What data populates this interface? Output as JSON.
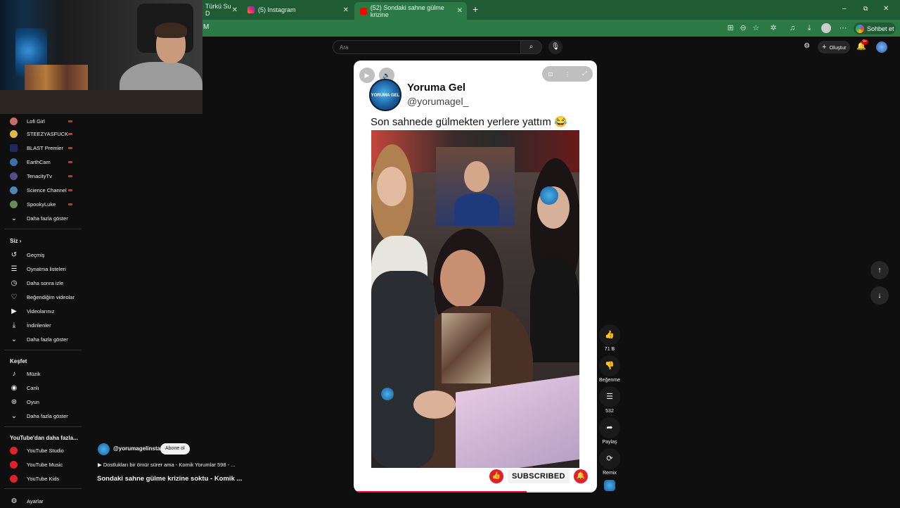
{
  "browser": {
    "tabs": [
      {
        "label": "Türkü Su D",
        "active": false
      },
      {
        "label": "(5) Instagram",
        "active": false
      },
      {
        "label": "(52) Sondaki sahne gülme krizine",
        "active": true
      }
    ],
    "new_tab": "+",
    "url_fragment": "M",
    "chat_button": "Sohbet et",
    "theme_color": "#2b7a45"
  },
  "youtube": {
    "search_placeholder": "Ara",
    "create_label": "Oluştur",
    "notif_count": "9+"
  },
  "sidebar": {
    "subscriptions": [
      {
        "label": "Lofi Girl",
        "color": "#c96b6b"
      },
      {
        "label": "STEEZYASFUCK",
        "color": "#e0b84a"
      },
      {
        "label": "BLAST Premier",
        "color": "#1d2a5a"
      },
      {
        "label": "EarthCam",
        "color": "#3b6fae"
      },
      {
        "label": "TenacityTv",
        "color": "#5a4a8a"
      },
      {
        "label": "Science Channel",
        "color": "#4a8ab0"
      },
      {
        "label": "SpookyLuke",
        "color": "#6a8a5a"
      }
    ],
    "show_more": "Daha fazla göster",
    "you_heading": "Siz",
    "you_items": [
      {
        "label": "Geçmiş",
        "icon": "history-icon",
        "glyph": "↺"
      },
      {
        "label": "Oynatma listeleri",
        "icon": "playlist-icon",
        "glyph": "☰"
      },
      {
        "label": "Daha sonra izle",
        "icon": "clock-icon",
        "glyph": "◷"
      },
      {
        "label": "Beğendiğim videolar",
        "icon": "thumbs-up-icon",
        "glyph": "👍"
      },
      {
        "label": "Videolarınız",
        "icon": "video-icon",
        "glyph": "▶"
      },
      {
        "label": "İndirilenler",
        "icon": "download-icon",
        "glyph": "⤓"
      }
    ],
    "show_more_2": "Daha fazla göster",
    "explore_heading": "Keşfet",
    "explore_items": [
      {
        "label": "Müzik",
        "icon": "music-icon",
        "glyph": "♪"
      },
      {
        "label": "Canlı",
        "icon": "live-icon",
        "glyph": "((•))"
      },
      {
        "label": "Oyun",
        "icon": "gamepad-icon",
        "glyph": "⊛"
      }
    ],
    "show_more_3": "Daha fazla göster",
    "more_heading": "YouTube'dan daha fazla...",
    "more_items": [
      {
        "label": "YouTube Studio",
        "color": "#e0202a"
      },
      {
        "label": "YouTube Music",
        "color": "#e0202a"
      },
      {
        "label": "YouTube Kids",
        "color": "#e0202a"
      }
    ],
    "settings": "Ayarlar"
  },
  "short": {
    "channel_name": "Yoruma Gel",
    "channel_handle": "@yorumagel_",
    "logo_text": "YORUMA GEL",
    "caption": "Son sahnede gülmekten yerlere yattım 😂",
    "subscribed_label": "SUBSCRIBED",
    "progress": 0.71
  },
  "actions": {
    "like_count": "71 B",
    "dislike_label": "Beğenme",
    "comment_count": "532",
    "share_label": "Paylaş",
    "remix_label": "Remix"
  },
  "info": {
    "handle": "@yorumagelinsta",
    "subscribe": "Abone ol",
    "playlist": "▶ Dostlukları bir ömür sürer ama - Komik Yorumlar 598 - ...",
    "title": "Sondaki sahne gülme krizine soktu - Komik ..."
  }
}
